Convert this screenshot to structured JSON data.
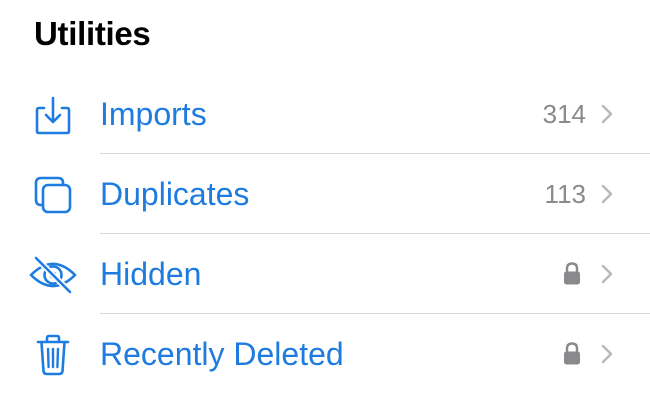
{
  "section": {
    "title": "Utilities"
  },
  "colors": {
    "accent": "#1e7ce0",
    "secondary": "#8a8a8e",
    "separator": "#d6d6d8"
  },
  "rows": [
    {
      "label": "Imports",
      "count": "314",
      "icon": "import-tray-icon",
      "locked": false
    },
    {
      "label": "Duplicates",
      "count": "113",
      "icon": "duplicates-icon",
      "locked": false
    },
    {
      "label": "Hidden",
      "count": "",
      "icon": "eye-slash-icon",
      "locked": true
    },
    {
      "label": "Recently Deleted",
      "count": "",
      "icon": "trash-icon",
      "locked": true
    }
  ]
}
